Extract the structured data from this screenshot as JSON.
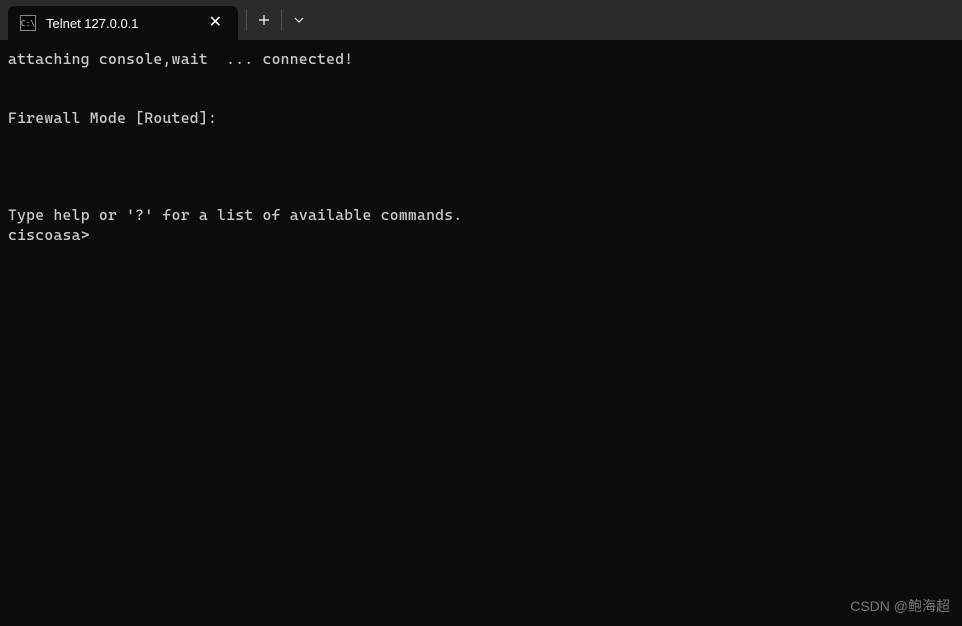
{
  "tab": {
    "icon_text": "C:\\",
    "title": "Telnet 127.0.0.1"
  },
  "terminal": {
    "line1": "attaching console,wait  ... connected!",
    "line2": "",
    "line3": "",
    "line4": "Firewall Mode [Routed]:",
    "line5": "",
    "line6": "",
    "line7": "",
    "line8": "",
    "line9": "Type help or '?' for a list of available commands.",
    "line10": "ciscoasa>"
  },
  "watermark": "CSDN @鲍海超"
}
